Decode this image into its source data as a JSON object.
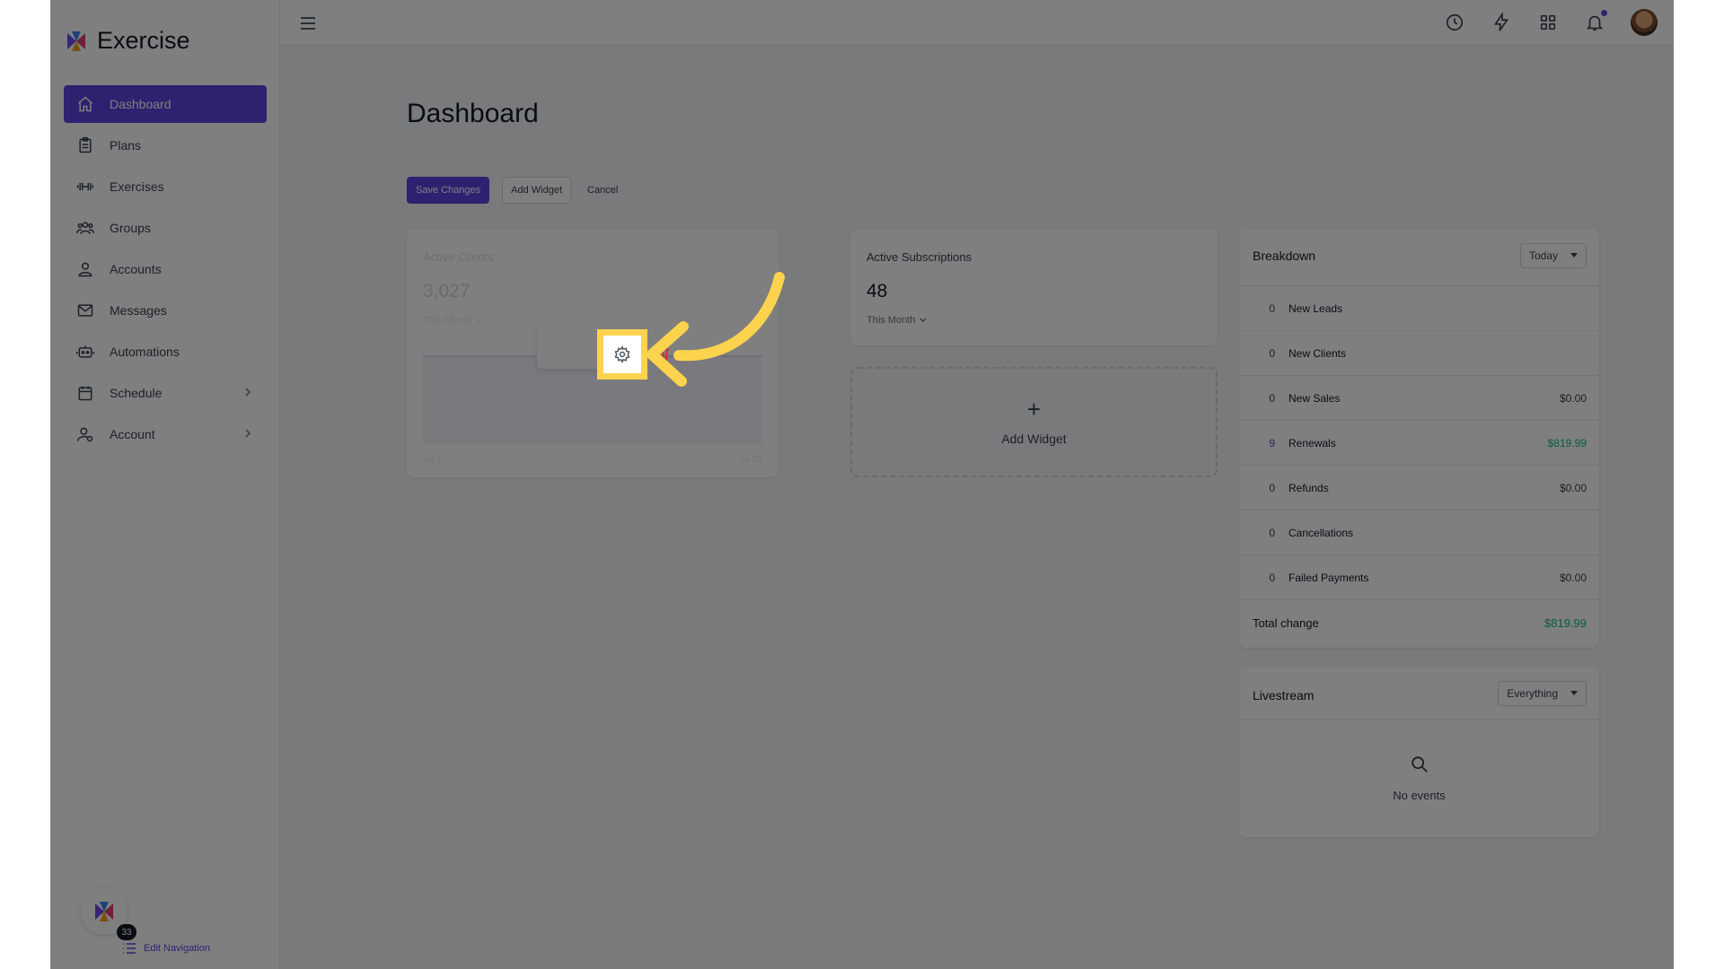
{
  "app": {
    "name": "Exercise"
  },
  "sidebar": {
    "items": [
      {
        "label": "Dashboard",
        "icon": "home-icon",
        "active": true
      },
      {
        "label": "Plans",
        "icon": "clipboard-icon"
      },
      {
        "label": "Exercises",
        "icon": "dumbbell-icon"
      },
      {
        "label": "Groups",
        "icon": "users-icon"
      },
      {
        "label": "Accounts",
        "icon": "user-icon"
      },
      {
        "label": "Messages",
        "icon": "mail-icon"
      },
      {
        "label": "Automations",
        "icon": "robot-icon"
      },
      {
        "label": "Schedule",
        "icon": "calendar-icon",
        "chevron": true
      },
      {
        "label": "Account",
        "icon": "user-gear-icon",
        "chevron": true
      }
    ],
    "badge_count": "33",
    "edit_navigation": "Edit Navigation"
  },
  "header": {
    "icons": [
      "clock-icon",
      "bolt-icon",
      "grid-icon",
      "bell-icon",
      "user-avatar"
    ]
  },
  "page": {
    "title": "Dashboard",
    "toolbar": {
      "save": "Save Changes",
      "add_widget": "Add Widget",
      "cancel": "Cancel"
    }
  },
  "widgets": {
    "active_clients": {
      "label": "Active Clients",
      "value": "3,027",
      "period": "This Month",
      "x_start": "Jul 1",
      "x_end": "Jul 31"
    },
    "active_subscriptions": {
      "label": "Active Subscriptions",
      "value": "48",
      "period": "This Month"
    },
    "add_widget": {
      "label": "Add Widget"
    }
  },
  "breakdown": {
    "title": "Breakdown",
    "range": "Today",
    "rows": [
      {
        "count": "0",
        "label": "New Leads",
        "amount": ""
      },
      {
        "count": "0",
        "label": "New Clients",
        "amount": ""
      },
      {
        "count": "0",
        "label": "New Sales",
        "amount": "$0.00"
      },
      {
        "count": "9",
        "label": "Renewals",
        "amount": "$819.99"
      },
      {
        "count": "0",
        "label": "Refunds",
        "amount": "$0.00"
      },
      {
        "count": "0",
        "label": "Cancellations",
        "amount": ""
      },
      {
        "count": "0",
        "label": "Failed Payments",
        "amount": "$0.00"
      }
    ],
    "total_label": "Total change",
    "total_amount": "$819.99"
  },
  "livestream": {
    "title": "Livestream",
    "filter": "Everything",
    "empty_text": "No events"
  },
  "colors": {
    "primary": "#5b45e0",
    "positive": "#10b981",
    "highlight": "#fcd34d",
    "danger": "#dc2626"
  }
}
